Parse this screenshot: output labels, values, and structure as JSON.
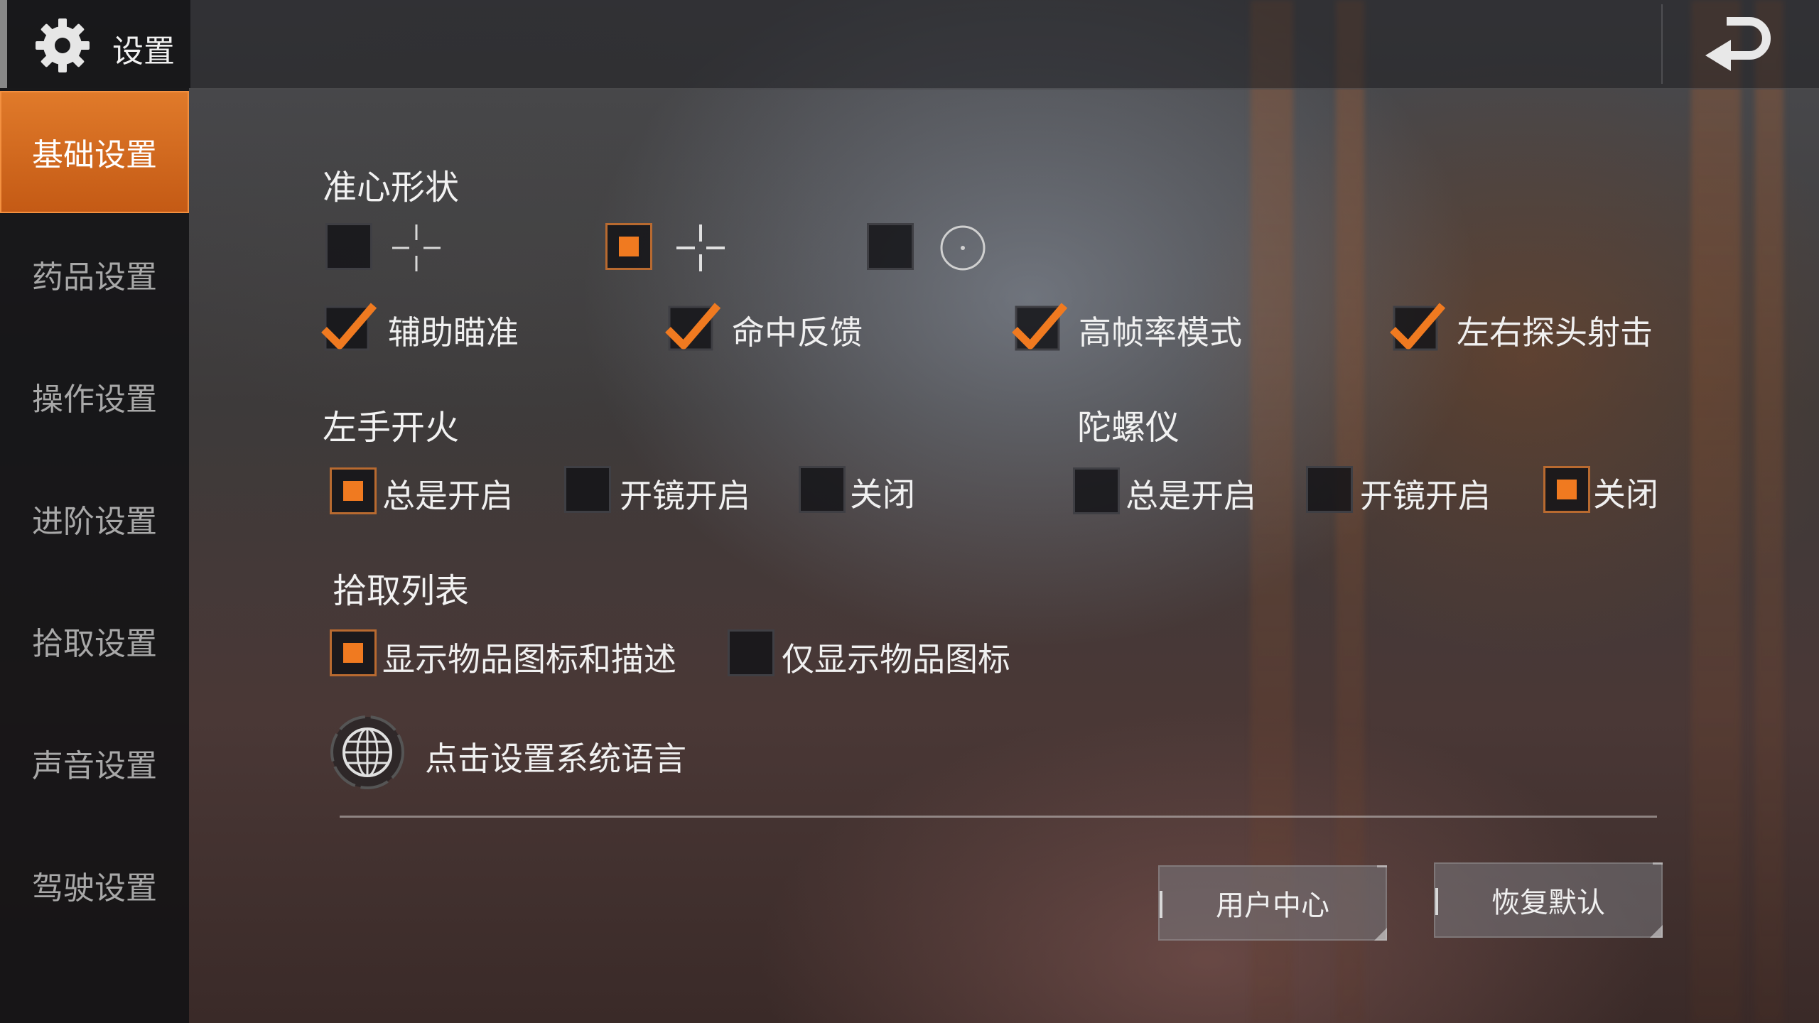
{
  "header": {
    "title": "设置",
    "settings_icon": "gear-icon",
    "back_icon": "back-arrow-icon"
  },
  "sidebar": {
    "items": [
      {
        "label": "基础设置",
        "active": true
      },
      {
        "label": "药品设置",
        "active": false
      },
      {
        "label": "操作设置",
        "active": false
      },
      {
        "label": "进阶设置",
        "active": false
      },
      {
        "label": "拾取设置",
        "active": false
      },
      {
        "label": "声音设置",
        "active": false
      },
      {
        "label": "驾驶设置",
        "active": false
      }
    ]
  },
  "crosshair": {
    "title": "准心形状",
    "options": [
      {
        "icon": "crosshair-thin-icon",
        "selected": false
      },
      {
        "icon": "crosshair-cross-icon",
        "selected": true
      },
      {
        "icon": "crosshair-dot-circle-icon",
        "selected": false
      }
    ]
  },
  "toggles": [
    {
      "label": "辅助瞄准",
      "checked": true
    },
    {
      "label": "命中反馈",
      "checked": true
    },
    {
      "label": "高帧率模式",
      "checked": true
    },
    {
      "label": "左右探头射击",
      "checked": true
    }
  ],
  "left_fire": {
    "title": "左手开火",
    "options": [
      {
        "label": "总是开启",
        "selected": true
      },
      {
        "label": "开镜开启",
        "selected": false
      },
      {
        "label": "关闭",
        "selected": false
      }
    ]
  },
  "gyroscope": {
    "title": "陀螺仪",
    "options": [
      {
        "label": "总是开启",
        "selected": false
      },
      {
        "label": "开镜开启",
        "selected": false
      },
      {
        "label": "关闭",
        "selected": true
      }
    ]
  },
  "pickup_list": {
    "title": "拾取列表",
    "options": [
      {
        "label": "显示物品图标和描述",
        "selected": true
      },
      {
        "label": "仅显示物品图标",
        "selected": false
      }
    ]
  },
  "language": {
    "label": "点击设置系统语言",
    "icon": "globe-icon"
  },
  "buttons": {
    "user_center": "用户中心",
    "restore_default": "恢复默认"
  },
  "colors": {
    "accent": "#f07a20",
    "active_tab": "#d86a20"
  }
}
